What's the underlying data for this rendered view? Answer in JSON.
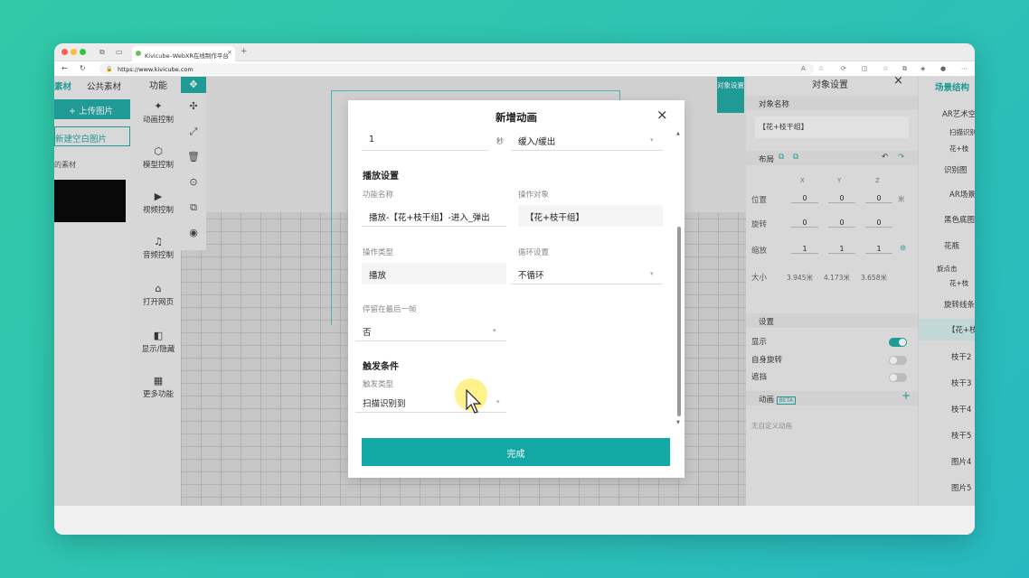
{
  "browser": {
    "tab_title": "Kivicube–WebXR在线制作平台",
    "tab_close": "×",
    "new_tab": "+",
    "url": "https://www.kivicube.com",
    "colors": {
      "close": "#ff5f57",
      "min": "#febc2e",
      "max": "#28c840"
    }
  },
  "left_panel": {
    "tab_material": "素材",
    "tab_public": "公共素材",
    "upload_button": "+ 上传图片",
    "new_blank_button": "新建空白图片",
    "section_label": "我的素材"
  },
  "function_panel": {
    "title": "功能",
    "items": [
      {
        "label": "动画控制",
        "icon": "✦"
      },
      {
        "label": "模型控制",
        "icon": "⬡"
      },
      {
        "label": "视频控制",
        "icon": "▶"
      },
      {
        "label": "音频控制",
        "icon": "♫"
      },
      {
        "label": "打开网页",
        "icon": "⌂"
      },
      {
        "label": "显示/隐藏",
        "icon": "◧"
      },
      {
        "label": "更多功能",
        "icon": "▦"
      }
    ]
  },
  "tools": [
    "✥",
    "✣",
    "⤢",
    "🗑",
    "⊙",
    "⧉",
    "◉"
  ],
  "object_button": "对象设置",
  "right_panel": {
    "title": "对象设置",
    "close": "×",
    "object_name_label": "对象名称",
    "object_name_value": "【花+枝干组】",
    "layout_label": "布局",
    "axes": [
      "X",
      "Y",
      "Z"
    ],
    "position_label": "位置",
    "position": [
      "0",
      "0",
      "0"
    ],
    "unit_m": "米",
    "rotation_label": "旋转",
    "rotation": [
      "0",
      "0",
      "0"
    ],
    "scale_label": "缩放",
    "scale": [
      "1",
      "1",
      "1"
    ],
    "size_label": "大小",
    "size": [
      "3.945米",
      "4.173米",
      "3.658米"
    ],
    "settings_label": "设置",
    "show_label": "显示",
    "self_rotate_label": "自身旋转",
    "occlusion_label": "遮挡",
    "animation_label": "动画",
    "beta": "BETA",
    "animation_add": "+",
    "no_custom_animation": "无自定义动画"
  },
  "scene_panel": {
    "title": "场景结构",
    "items": [
      "AR艺术空",
      "扫描识别",
      "花+枝",
      "识别图",
      "AR场景",
      "黑色底图",
      "花瓶",
      "旋点击",
      "花+枝",
      "旋转线条",
      "【花+枝",
      "枝干2",
      "枝干3",
      "枝干4",
      "枝干5",
      "图片4",
      "图片5"
    ]
  },
  "modal": {
    "title": "新增动画",
    "close": "×",
    "duration_value": "1",
    "duration_unit": "秒",
    "easing_value": "缓入/缓出",
    "play_settings": "播放设置",
    "function_name_label": "功能名称",
    "function_name_value": "播放-【花+枝干组】-进入_弹出",
    "target_label": "操作对象",
    "target_value": "【花+枝干组】",
    "operation_type_label": "操作类型",
    "operation_type_value": "播放",
    "loop_label": "循环设置",
    "loop_value": "不循环",
    "stop_last_label": "停留在最后一帧",
    "stop_last_value": "否",
    "trigger_section": "触发条件",
    "trigger_type_label": "触发类型",
    "trigger_type_value": "扫描识别到",
    "done_button": "完成"
  }
}
